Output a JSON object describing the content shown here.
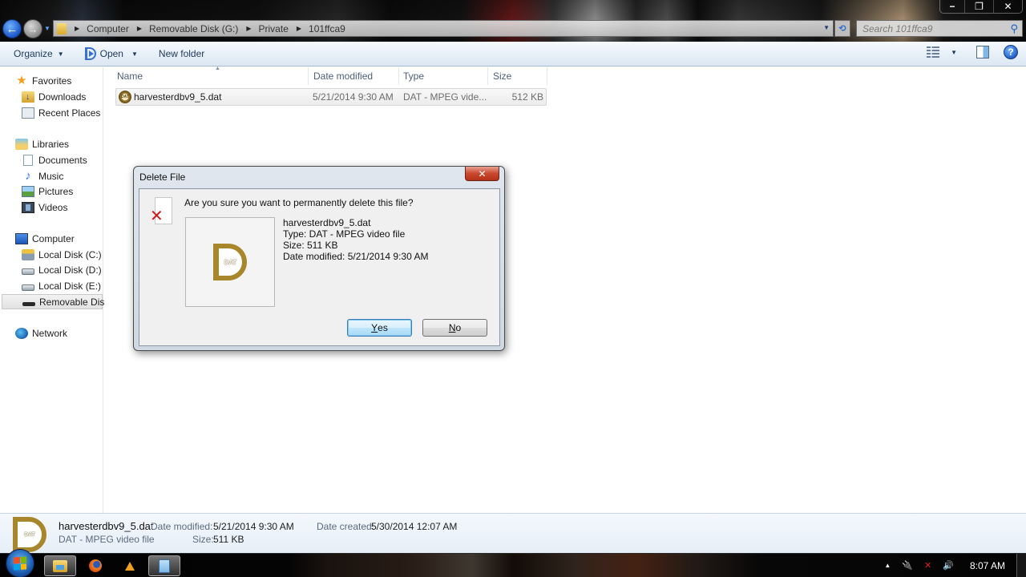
{
  "window": {
    "controls": {
      "minimize": "−",
      "restore": "❐",
      "close": "✕"
    }
  },
  "nav": {
    "back_icon": "←",
    "forward_icon": "→",
    "recent_icon": "▼"
  },
  "address": {
    "breadcrumbs": [
      "Computer",
      "Removable Disk (G:)",
      "Private",
      "101ffca9"
    ],
    "separator": "▶",
    "dropdown_icon": "▼",
    "refresh_icon": "⟲"
  },
  "search": {
    "placeholder": "Search 101ffca9",
    "icon": "⚲"
  },
  "toolbar": {
    "organize_label": "Organize",
    "open_label": "Open",
    "new_folder_label": "New folder",
    "dropdown_arrow": "▼",
    "help_label": "?"
  },
  "sidebar": {
    "items": [
      {
        "label": "Favorites",
        "icon": "star-icon"
      },
      {
        "label": "Downloads",
        "icon": "downloads-folder-icon"
      },
      {
        "label": "Recent Places",
        "icon": "recent-places-icon"
      },
      {
        "label": "Libraries",
        "icon": "libraries-icon"
      },
      {
        "label": "Documents",
        "icon": "documents-icon"
      },
      {
        "label": "Music",
        "icon": "music-icon"
      },
      {
        "label": "Pictures",
        "icon": "pictures-icon"
      },
      {
        "label": "Videos",
        "icon": "videos-icon"
      },
      {
        "label": "Computer",
        "icon": "computer-icon"
      },
      {
        "label": "Local Disk (C:)",
        "icon": "system-disk-icon"
      },
      {
        "label": "Local Disk (D:)",
        "icon": "disk-icon"
      },
      {
        "label": "Local Disk (E:)",
        "icon": "disk-icon"
      },
      {
        "label": "Removable Disk",
        "icon": "removable-disk-icon",
        "selected": true
      },
      {
        "label": "Network",
        "icon": "network-icon"
      }
    ],
    "star_glyph": "★",
    "music_glyph": "♪"
  },
  "file_list": {
    "columns": [
      "Name",
      "Date modified",
      "Type",
      "Size"
    ],
    "sort_indicator": "▲",
    "rows": [
      {
        "name": "harvesterdbv9_5.dat",
        "date_modified": "5/21/2014 9:30 AM",
        "type": "DAT - MPEG vide...",
        "size": "512 KB",
        "icon_label": "DAT"
      }
    ]
  },
  "dialog": {
    "title": "Delete File",
    "close_label": "✕",
    "question": "Are you sure you want to permanently delete this file?",
    "delete_mark": "✕",
    "preview_label": "DAT",
    "file_name": "harvesterdbv9_5.dat",
    "file_type": "Type: DAT - MPEG video file",
    "file_size": "Size: 511 KB",
    "file_date": "Date modified: 5/21/2014 9:30 AM",
    "yes_accel": "Y",
    "yes_rest": "es",
    "no_accel": "N",
    "no_rest": "o"
  },
  "details": {
    "icon_label": "DAT",
    "file_name": "harvesterdbv9_5.dat",
    "file_type": "DAT - MPEG video file",
    "date_modified_label": "Date modified:",
    "date_modified": "5/21/2014 9:30 AM",
    "size_label": "Size:",
    "size": "511 KB",
    "date_created_label": "Date created:",
    "date_created": "5/30/2014 12:07 AM"
  },
  "taskbar": {
    "apps": [
      "Windows Explorer",
      "Firefox",
      "VLC",
      "Notepad"
    ],
    "tray": {
      "show_hidden": "▲",
      "power": "🔌",
      "network": "✕",
      "volume": "🔊"
    },
    "clock": "8:07 AM"
  }
}
